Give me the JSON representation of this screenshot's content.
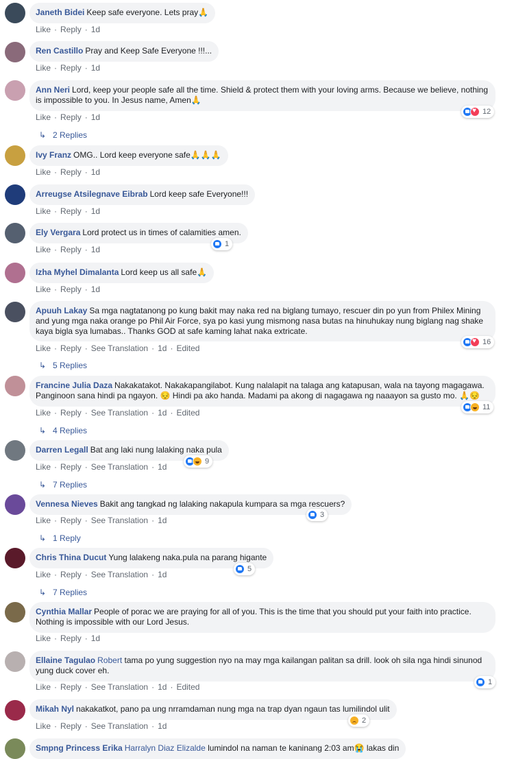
{
  "labels": {
    "like": "Like",
    "reply": "Reply",
    "see_translation": "See Translation",
    "edited": "Edited"
  },
  "comments": [
    {
      "author": "Janeth Bidei",
      "text": "Keep safe everyone. Lets pray🙏",
      "time": "1d",
      "avatar_color": "#3a4a5a"
    },
    {
      "author": "Ren Castillo",
      "text": "Pray and Keep Safe Everyone !!!...",
      "time": "1d",
      "avatar_color": "#8a6a7a"
    },
    {
      "author": "Ann Neri",
      "text": "Lord, keep your people safe all the time. Shield & protect them with your loving arms. Because we believe, nothing is impossible to you. In Jesus name, Amen🙏",
      "time": "1d",
      "reaction_count": "12",
      "replies": "2 Replies",
      "avatar_color": "#c9a0b0"
    },
    {
      "author": "Ivy Franz",
      "text": "OMG.. Lord keep everyone safe🙏🙏🙏",
      "time": "1d",
      "avatar_color": "#c8a040"
    },
    {
      "author": "Arreugse Atsilegnave Eibrab",
      "text": "Lord keep safe Everyone!!!",
      "time": "1d",
      "avatar_color": "#1f3c7a"
    },
    {
      "author": "Ely Vergara",
      "text": "Lord protect us in times of calamities amen.",
      "time": "1d",
      "reaction_count": "1",
      "avatar_color": "#556070"
    },
    {
      "author": "Izha Myhel Dimalanta",
      "text": "Lord keep us all safe🙏",
      "time": "1d",
      "avatar_color": "#b07090"
    },
    {
      "author": "Apuuh Lakay",
      "text": "Sa mga nagtatanong po kung bakit may naka red na biglang tumayo, rescuer din po yun from Philex Mining and yung mga naka orange po Phil Air Force, sya po kasi yung mismong nasa butas na hinuhukay nung biglang nag shake kaya bigla sya lumabas.. Thanks GOD at safe kaming lahat naka extricate.",
      "time": "1d",
      "reaction_count": "16",
      "replies": "5 Replies",
      "avatar_color": "#4a5060"
    },
    {
      "author": "Francine Julia Daza",
      "text": "Nakakatakot. Nakakapangilabot. Kung nalalapit na talaga ang katapusan, wala na tayong magagawa. Panginoon sana hindi pa ngayon. 😔 Hindi pa ako handa. Madami pa akong di nagagawa ng naaayon sa gusto mo. 🙏😔",
      "time": "1d",
      "reaction_count": "11",
      "replies": "4 Replies",
      "avatar_color": "#c09098"
    },
    {
      "author": "Darren Legall",
      "text": "Bat ang laki nung lalaking naka pula",
      "time": "1d",
      "reaction_count": "9",
      "replies": "7 Replies",
      "avatar_color": "#707880"
    },
    {
      "author": "Vennesa Nieves",
      "text": "Bakit ang tangkad ng lalaking nakapula kumpara sa mga rescuers?",
      "time": "1d",
      "reaction_count": "3",
      "replies": "1 Reply",
      "avatar_color": "#6a4a9a"
    },
    {
      "author": "Chris Thina Ducut",
      "text": "Yung lalakeng naka.pula na parang higante",
      "time": "1d",
      "reaction_count": "5",
      "replies": "7 Replies",
      "avatar_color": "#5a1a2a"
    },
    {
      "author": "Cynthia Mallar",
      "text": "People of porac we are praying for all of you. This is the time that you should put your faith into practice. Nothing is impossible with our Lord Jesus.",
      "time": "1d",
      "avatar_color": "#7a6a4a"
    },
    {
      "author": "Ellaine Tagulao",
      "mention": "Robert",
      "text": "tama po yung suggestion nyo na may mga kailangan palitan sa drill. look oh sila nga hindi sinunod yung duck cover eh.",
      "time": "1d",
      "reaction_count": "1",
      "avatar_color": "#b8b0b0"
    },
    {
      "author": "Mikah Nyl",
      "text": "nakakatkot, pano pa ung nrramdaman nung mga na trap dyan ngaun tas lumilindol ulit",
      "time": "1d",
      "reaction_count": "2",
      "avatar_color": "#9a2a4a"
    },
    {
      "author": "Smpng Princess Erika",
      "mention": "Harralyn Diaz Elizalde",
      "text": "lumindol na naman te kaninang 2:03 am😭 lakas din",
      "avatar_color": "#7a8a5a"
    }
  ]
}
